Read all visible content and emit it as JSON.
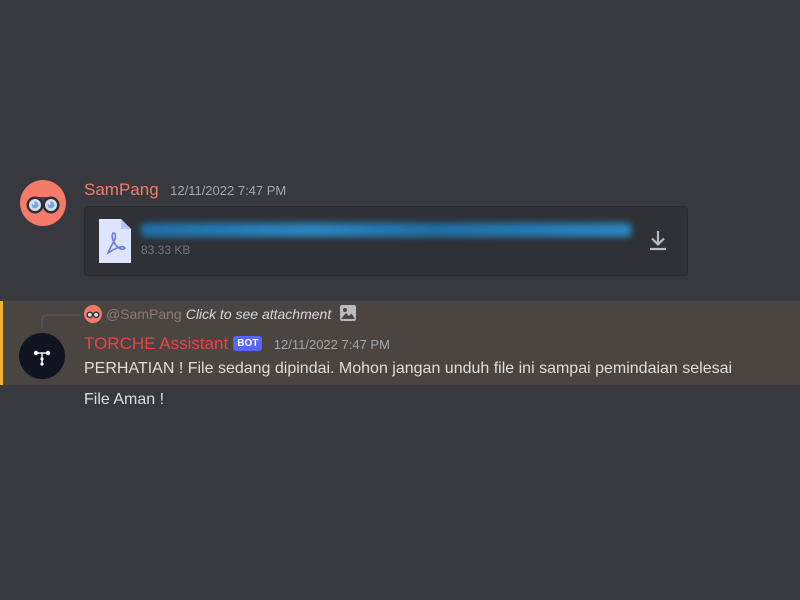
{
  "messages": [
    {
      "author": "SamPang",
      "author_color": "#f47b67",
      "timestamp": "12/11/2022 7:47 PM",
      "avatar_icon": "binoculars-icon",
      "attachment": {
        "type": "pdf",
        "file_icon": "pdf-file-icon",
        "file_name": "",
        "file_size": "83.33 KB",
        "download_icon": "download-icon"
      }
    },
    {
      "author": "TORCHE Assistant",
      "author_color": "#ed4245",
      "badge": "BOT",
      "timestamp": "12/11/2022 7:47 PM",
      "avatar_icon": "torche-logo-icon",
      "highlight_color": "#f0b232",
      "reply": {
        "mention": "@SamPang",
        "text": "Click to see attachment",
        "image_icon": "image-icon"
      },
      "text": "PERHATIAN ! File sedang dipindai. Mohon jangan unduh file ini sampai pemindaian selesai"
    },
    {
      "text": "File Aman !"
    }
  ]
}
